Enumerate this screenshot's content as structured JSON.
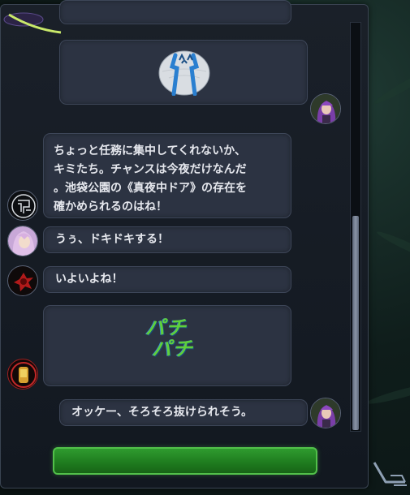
{
  "chat": {
    "messages": [
      {
        "id": "m1",
        "side": "right",
        "type": "stamp",
        "stamp": "crying-round-face-stamp"
      },
      {
        "id": "m2",
        "side": "left",
        "type": "text",
        "text": "ちょっと任務に集中してくれないか、\nキミたち。チャンスは今夜だけなんだ\n。池袋公園の《真夜中ドア》の存在を\n確かめられるのはね！"
      },
      {
        "id": "m3",
        "side": "left",
        "type": "text",
        "text": "うぅ、ドキドキする！"
      },
      {
        "id": "m4",
        "side": "left",
        "type": "text",
        "text": "いよいよね！"
      },
      {
        "id": "m5",
        "side": "left",
        "type": "stamp",
        "stamp": "pachi-pachi-clap-stamp",
        "stamp_text_line1": "パチ",
        "stamp_text_line2": "パチ"
      },
      {
        "id": "m6",
        "side": "right",
        "type": "text",
        "text": "オッケー、そろそろ抜けられそう。"
      }
    ]
  },
  "colors": {
    "bubble": "#2c3342",
    "input_bar": "#1f7d1f",
    "input_border": "#52c04a",
    "text": "#e6e8ee"
  },
  "scrollbar": {
    "position_fraction": 0.52
  },
  "icons": {
    "avatar_purple_hair": "purple-hair-girl-avatar-icon",
    "avatar_logo": "white-line-emblem-avatar-icon",
    "avatar_pink_hair": "pink-hair-girl-avatar-icon",
    "avatar_red_emblem": "red-emblem-avatar-icon",
    "avatar_red_device": "red-device-avatar-icon",
    "resize": "resize-handle-icon"
  }
}
